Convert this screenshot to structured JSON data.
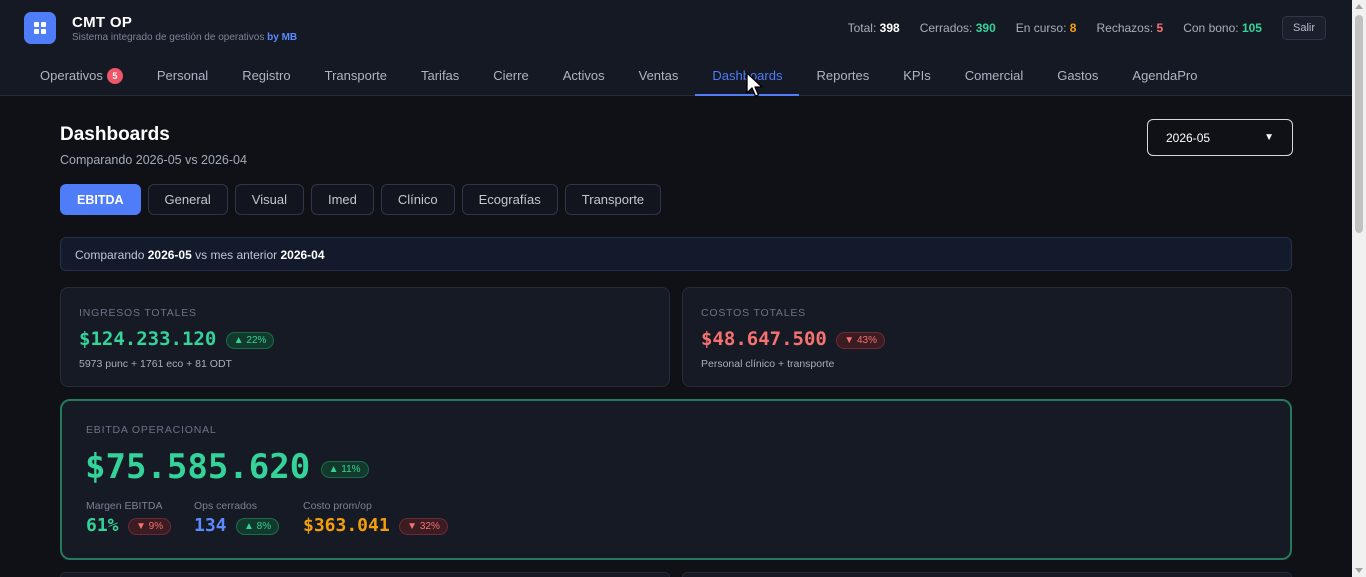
{
  "header": {
    "title": "CMT OP",
    "subtitle": "Sistema integrado de gestión de operativos",
    "subtitle_by": "by MB",
    "exit_label": "Salir",
    "stats": [
      {
        "label": "Total:",
        "value": "398",
        "color": "#ffffff"
      },
      {
        "label": "Cerrados:",
        "value": "390",
        "color": "#34d399"
      },
      {
        "label": "En curso:",
        "value": "8",
        "color": "#f59e0b"
      },
      {
        "label": "Rechazos:",
        "value": "5",
        "color": "#f87171"
      },
      {
        "label": "Con bono:",
        "value": "105",
        "color": "#34d399"
      }
    ]
  },
  "nav": {
    "items": [
      {
        "label": "Operativos",
        "badge": "5"
      },
      {
        "label": "Personal"
      },
      {
        "label": "Registro"
      },
      {
        "label": "Transporte"
      },
      {
        "label": "Tarifas"
      },
      {
        "label": "Cierre"
      },
      {
        "label": "Activos"
      },
      {
        "label": "Ventas"
      },
      {
        "label": "Dashboards",
        "active": true
      },
      {
        "label": "Reportes"
      },
      {
        "label": "KPIs"
      },
      {
        "label": "Comercial"
      },
      {
        "label": "Gastos"
      },
      {
        "label": "AgendaPro"
      }
    ]
  },
  "page": {
    "title": "Dashboards",
    "subtitle": "Comparando 2026-05 vs 2026-04",
    "month_selected": "2026-05",
    "tabs": [
      "EBITDA",
      "General",
      "Visual",
      "Imed",
      "Clínico",
      "Ecografías",
      "Transporte"
    ],
    "active_tab": "EBITDA",
    "compare": {
      "prefix": "Comparando",
      "current": "2026-05",
      "middle": "vs mes anterior",
      "previous": "2026-04"
    }
  },
  "cards": {
    "income": {
      "label": "INGRESOS TOTALES",
      "value": "$124.233.120",
      "delta": "▲ 22%",
      "note": "5973 punc + 1761 eco + 81 ODT"
    },
    "costs": {
      "label": "COSTOS TOTALES",
      "value": "$48.647.500",
      "delta": "▼ 43%",
      "note": "Personal clínico + transporte"
    },
    "ebitda": {
      "label": "EBITDA OPERACIONAL",
      "value": "$75.585.620",
      "delta": "▲ 11%",
      "metrics": [
        {
          "label": "Margen EBITDA",
          "value": "61%",
          "delta": "▼ 9%",
          "color": "#34d399",
          "trend": "down"
        },
        {
          "label": "Ops cerrados",
          "value": "134",
          "delta": "▲ 8%",
          "color": "#5b8bff",
          "trend": "up"
        },
        {
          "label": "Costo prom/op",
          "value": "$363.041",
          "delta": "▼ 32%",
          "color": "#f59e0b",
          "trend": "down"
        }
      ]
    }
  }
}
